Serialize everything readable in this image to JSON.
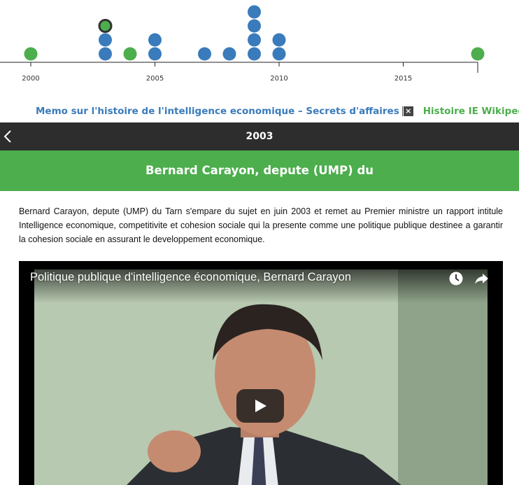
{
  "timeline": {
    "axis": {
      "ticks": [
        {
          "year": 2000,
          "label": "2000"
        },
        {
          "year": 2005,
          "label": "2005"
        },
        {
          "year": 2010,
          "label": "2010"
        },
        {
          "year": 2015,
          "label": "2015"
        }
      ],
      "range": [
        1999,
        2019
      ]
    },
    "events": [
      {
        "year": 2000,
        "stack": 0,
        "color": "green"
      },
      {
        "year": 2003,
        "stack": 0,
        "color": "blue"
      },
      {
        "year": 2003,
        "stack": 1,
        "color": "blue"
      },
      {
        "year": 2003,
        "stack": 2,
        "color": "green",
        "selected": true
      },
      {
        "year": 2004,
        "stack": 0,
        "color": "green"
      },
      {
        "year": 2005,
        "stack": 0,
        "color": "blue"
      },
      {
        "year": 2005,
        "stack": 1,
        "color": "blue"
      },
      {
        "year": 2007,
        "stack": 0,
        "color": "blue"
      },
      {
        "year": 2008,
        "stack": 0,
        "color": "blue"
      },
      {
        "year": 2009,
        "stack": 0,
        "color": "blue"
      },
      {
        "year": 2009,
        "stack": 1,
        "color": "blue"
      },
      {
        "year": 2009,
        "stack": 2,
        "color": "blue"
      },
      {
        "year": 2009,
        "stack": 3,
        "color": "blue"
      },
      {
        "year": 2010,
        "stack": 0,
        "color": "blue"
      },
      {
        "year": 2010,
        "stack": 1,
        "color": "blue"
      },
      {
        "year": 2018,
        "stack": 0,
        "color": "green"
      }
    ],
    "colors": {
      "blue": "#3a7bbb",
      "green": "#4cae4c",
      "selected_stroke": "#333333"
    }
  },
  "legend": {
    "source_blue": "Memo sur l'histoire de l'intelligence economique – Secrets d'affaires",
    "remove_icon": "×",
    "source_green": "Histoire IE Wikipedia"
  },
  "header": {
    "year": "2003"
  },
  "event": {
    "title": "Bernard Carayon, depute (UMP) du",
    "description": "Bernard Carayon, depute (UMP) du Tarn s'empare du sujet en juin 2003 et remet au Premier ministre un rapport intitule Intelligence economique, competitivite et cohesion sociale qui la presente comme une politique publique destinee a garantir la cohesion sociale en assurant le developpement economique."
  },
  "video": {
    "title": "Politique publique d'intelligence économique, Bernard Carayon"
  },
  "icons": {
    "back": "chevron-left-icon",
    "watch_later": "clock-icon",
    "share": "share-arrow-icon",
    "play": "play-icon",
    "remove": "close-icon"
  }
}
